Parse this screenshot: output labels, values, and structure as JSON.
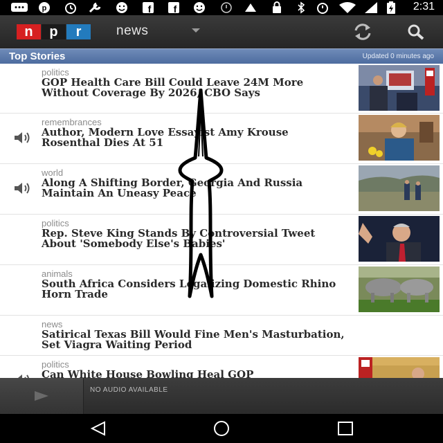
{
  "status_bar": {
    "time": "2:31",
    "icons": [
      "messages-icon",
      "pinterest-icon",
      "alarm-icon",
      "tools-icon",
      "smiley-icon",
      "facebook-icon",
      "facebook-icon",
      "smiley-icon",
      "clock-icon",
      "notification-icon",
      "lock-icon",
      "bluetooth-icon",
      "alarm-icon",
      "wifi-icon",
      "battery-icon"
    ]
  },
  "app_bar": {
    "logo_letters": [
      "n",
      "p",
      "r"
    ],
    "logo_colors": [
      "#d62021",
      "#1b1b1b",
      "#237bbd"
    ],
    "section": "news"
  },
  "section_header": {
    "title": "Top Stories",
    "updated": "Updated 0 minutes ago"
  },
  "stories": [
    {
      "category": "politics",
      "headline": "GOP Health Care Bill Could Leave 24M More Without Coverage By 2026, CBO Says",
      "audio": false,
      "thumb": "press-conference-photo"
    },
    {
      "category": "remembrances",
      "headline": "Author, Modern Love Essayist Amy Krouse Rosenthal Dies At 51",
      "audio": true,
      "thumb": "author-portrait-photo"
    },
    {
      "category": "world",
      "headline": "Along A Shifting Border, Georgia And Russia Maintain An Uneasy Peace",
      "audio": true,
      "thumb": "border-landscape-photo"
    },
    {
      "category": "politics",
      "headline": "Rep. Steve King Stands By Controversial Tweet About 'Somebody Else's Babies'",
      "audio": false,
      "thumb": "congressman-photo"
    },
    {
      "category": "animals",
      "headline": "South Africa Considers Legalizing Domestic Rhino Horn Trade",
      "audio": false,
      "thumb": "rhinos-photo"
    },
    {
      "category": "news",
      "headline": "Satirical Texas Bill Would Fine Men's Masturbation, Set Viagra Waiting Period",
      "audio": false,
      "thumb": ""
    },
    {
      "category": "politics",
      "headline": "Can White House Bowling Heal GOP",
      "audio": true,
      "thumb": "white-house-photo"
    }
  ],
  "player": {
    "status": "NO AUDIO AVAILABLE"
  },
  "colors": {
    "header_blue": "#5a77a8",
    "app_bar": "#2f2f2f",
    "headline_text": "#2a2a2a",
    "category_text": "#8c8c8c"
  }
}
